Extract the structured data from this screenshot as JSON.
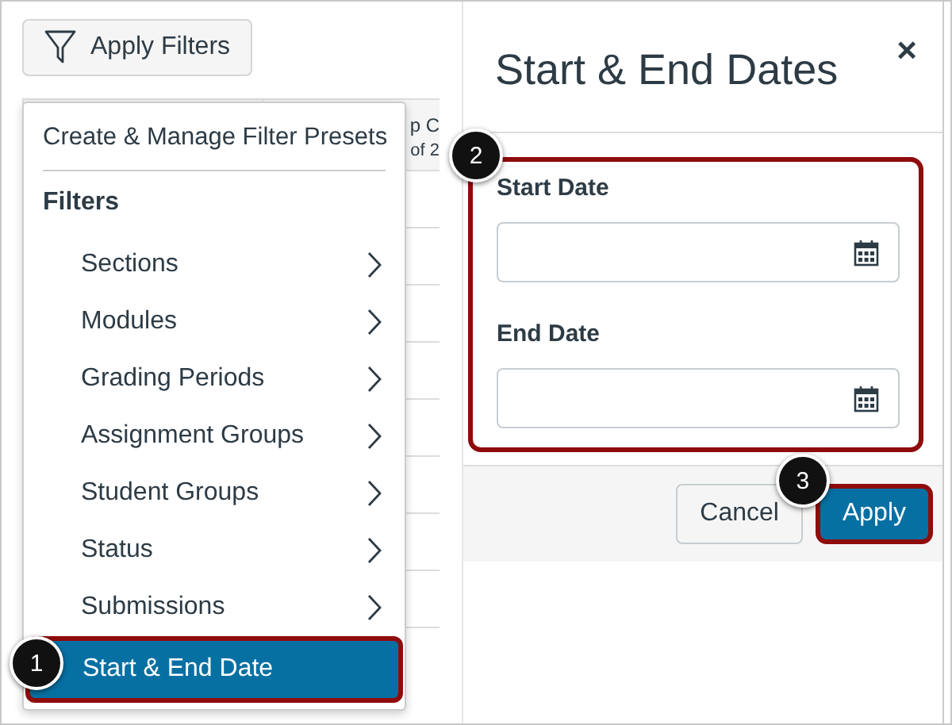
{
  "toolbar": {
    "button": "Apply Filters"
  },
  "table_background": {
    "header_fragments": [
      "p C",
      "of 2"
    ]
  },
  "menu": {
    "presets": "Create & Manage Filter Presets",
    "heading": "Filters",
    "items": [
      {
        "label": "Sections",
        "submenu": true,
        "selected": false
      },
      {
        "label": "Modules",
        "submenu": true,
        "selected": false
      },
      {
        "label": "Grading Periods",
        "submenu": true,
        "selected": false
      },
      {
        "label": "Assignment Groups",
        "submenu": true,
        "selected": false
      },
      {
        "label": "Student Groups",
        "submenu": true,
        "selected": false
      },
      {
        "label": "Status",
        "submenu": true,
        "selected": false
      },
      {
        "label": "Submissions",
        "submenu": true,
        "selected": false
      },
      {
        "label": "Start & End Date",
        "submenu": false,
        "selected": true,
        "callout": "1"
      }
    ]
  },
  "dialog": {
    "title": "Start & End Dates",
    "close": "×",
    "fields_callout": "2",
    "fields": [
      {
        "label": "Start Date"
      },
      {
        "label": "End Date"
      }
    ],
    "buttons": [
      {
        "label": "Cancel",
        "kind": "secondary",
        "highlighted": false
      },
      {
        "label": "Apply",
        "kind": "primary",
        "highlighted": true,
        "callout": "3"
      }
    ]
  }
}
